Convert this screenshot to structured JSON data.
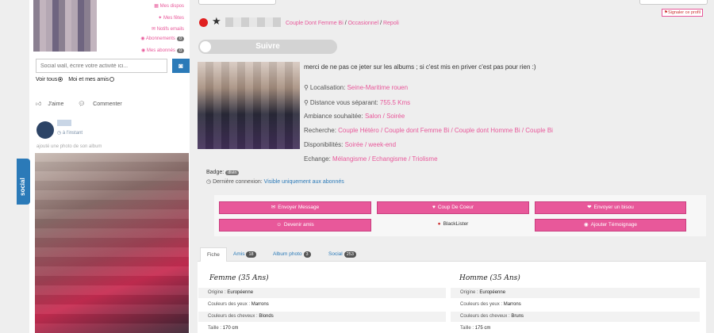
{
  "quick_links": [
    {
      "label": "Mes dispos",
      "count": ""
    },
    {
      "label": "Mes fêtes",
      "count": ""
    },
    {
      "label": "Notifs emails",
      "count": ""
    },
    {
      "label": "Abonnements",
      "count": "0"
    },
    {
      "label": "Mes abonnés",
      "count": "0"
    }
  ],
  "social_wall": {
    "placeholder": "Social wall, écrire votre activité ici...",
    "camera_icon": "camera-icon",
    "filter_all": "Voir tous",
    "filter_friends": "Moi et mes amis",
    "like_label": "J'aime",
    "comment_label": "Commenter",
    "post_time": "à l'instant",
    "post_caption": "ajouté une photo de son album"
  },
  "social_tab": {
    "label": "social"
  },
  "profile": {
    "types": [
      "Couple Dont Femme Bi",
      "Occasionnel",
      "Repoli"
    ],
    "follow_label": "Suivre",
    "report_label": "Signaler ce profil",
    "bio": "merci de ne pas ce jeter sur les albums ; si c'est mis en priver c'est pas pour rien :)",
    "info": [
      {
        "icon": "map-marker-icon",
        "label": "Localisation:",
        "value": "Seine-Maritime rouen"
      },
      {
        "icon": "map-marker-icon",
        "label": "Distance vous séparant:",
        "value": "755.5 Kms"
      },
      {
        "icon": "",
        "label": "Ambiance souhaitée:",
        "value": "Salon / Soirée"
      },
      {
        "icon": "",
        "label": "Recherche:",
        "value": "Couple Hétéro / Couple dont Femme Bi / Couple dont Homme Bi / Couple Bi"
      },
      {
        "icon": "",
        "label": "Disponibilités:",
        "value": "Soirée / week-end"
      },
      {
        "icon": "",
        "label": "Echange:",
        "value": "Mélangisme / Echangisme / Triolisme"
      }
    ],
    "badge_label": "Badge:",
    "badge_value": "divin",
    "last_login_label": "Dernière connexion:",
    "last_login_value": "Visible uniquement aux abonnés"
  },
  "actions": {
    "send_message": "Envoyer Message",
    "crush": "Coup De Coeur",
    "kiss": "Envoyer un bisou",
    "become_friend": "Devenir amis",
    "blacklist": "BlackLister",
    "testimony": "Ajouter Témoignage"
  },
  "tabs": [
    {
      "label": "Fiche",
      "count": ""
    },
    {
      "label": "Amis",
      "count": "18"
    },
    {
      "label": "Album photo",
      "count": "3"
    },
    {
      "label": "Social",
      "count": "253"
    }
  ],
  "details": {
    "woman": {
      "title": "Femme (35 Ans)",
      "rows": [
        {
          "label": "Origine :",
          "value": "Européenne"
        },
        {
          "label": "Couleurs des yeux :",
          "value": "Marrons"
        },
        {
          "label": "Couleurs des cheveux :",
          "value": "Blonds"
        },
        {
          "label": "Taille :",
          "value": "170 cm"
        }
      ]
    },
    "man": {
      "title": "Homme (35 Ans)",
      "rows": [
        {
          "label": "Origine :",
          "value": "Européenne"
        },
        {
          "label": "Couleurs des yeux :",
          "value": "Marrons"
        },
        {
          "label": "Couleurs des cheveux :",
          "value": "Bruns"
        },
        {
          "label": "Taille :",
          "value": "175 cm"
        }
      ]
    }
  },
  "colors": {
    "accent": "#e8589a",
    "brand_blue": "#2b7ab8",
    "online": "#e02020"
  }
}
